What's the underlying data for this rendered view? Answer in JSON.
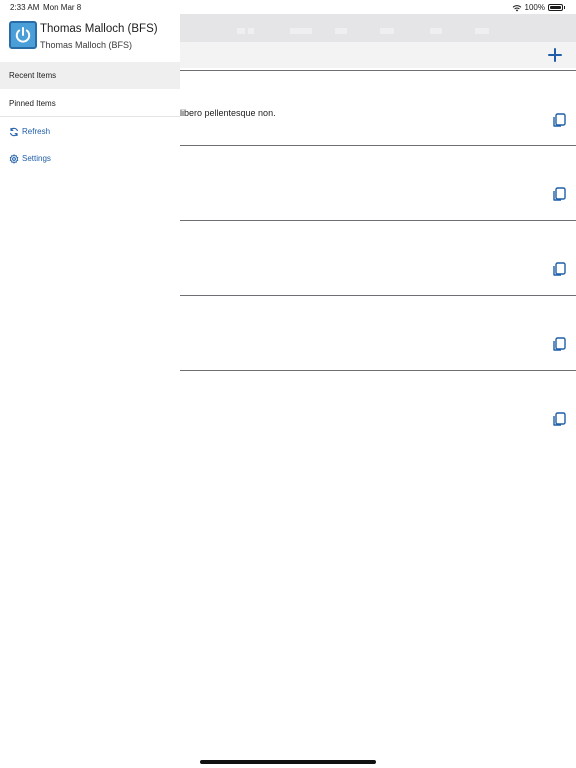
{
  "status_bar": {
    "time": "2:33 AM",
    "date": "Mon Mar 8",
    "battery": "100%"
  },
  "drawer": {
    "profile": {
      "name": "Thomas Malloch (BFS)",
      "subname": "Thomas Malloch (BFS)",
      "avatar_icon": "power-icon"
    },
    "items": [
      {
        "label": "Recent Items",
        "selected": true
      },
      {
        "label": "Pinned Items"
      },
      {
        "label": "Refresh",
        "icon": "refresh-icon"
      },
      {
        "label": "Settings",
        "icon": "gear-icon"
      }
    ]
  },
  "main": {
    "rows": [
      {
        "text": "libero pellentesque non.",
        "icon": "copy-icon"
      },
      {
        "text": "",
        "icon": "copy-icon"
      },
      {
        "text": "",
        "icon": "copy-icon"
      },
      {
        "text": "",
        "icon": "copy-icon"
      },
      {
        "text": "",
        "icon": "copy-icon"
      }
    ],
    "add_icon": "plus-icon"
  },
  "colors": {
    "accent": "#1f5ea8",
    "selected_bg": "#efeff0",
    "avatar": "#4a9fd8"
  }
}
